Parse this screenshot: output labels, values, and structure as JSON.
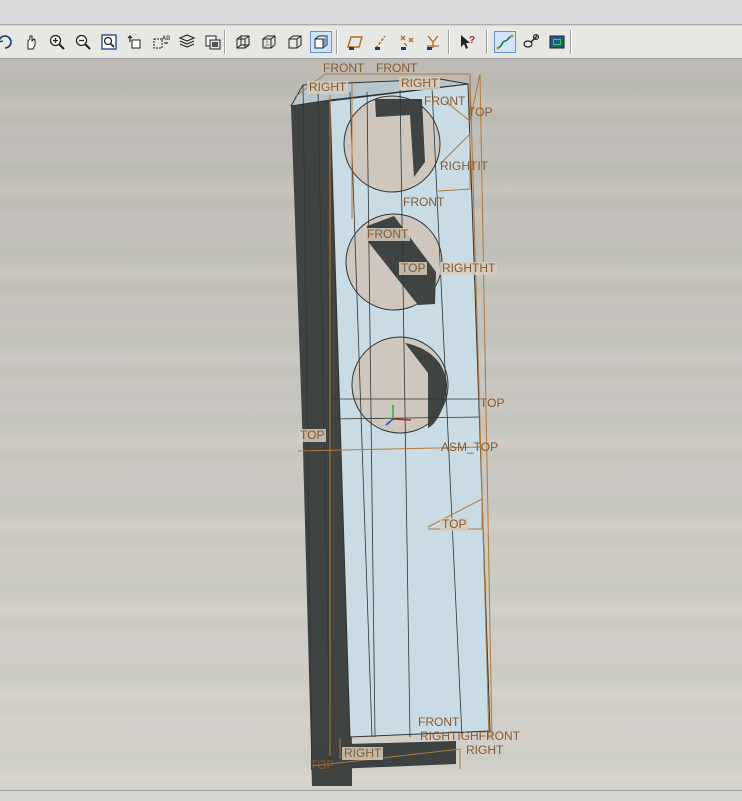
{
  "toolbar": {
    "buttons": [
      {
        "id": "repaint",
        "icon": "repaint-icon"
      },
      {
        "id": "spin",
        "icon": "spin-center-icon"
      },
      {
        "id": "zoom-in",
        "icon": "zoom-in-icon"
      },
      {
        "id": "zoom-out",
        "icon": "zoom-out-icon"
      },
      {
        "id": "refit",
        "icon": "refit-icon"
      },
      {
        "id": "reorient",
        "icon": "reorient-icon"
      },
      {
        "id": "saved-views",
        "icon": "saved-views-icon"
      },
      {
        "id": "layers",
        "icon": "layers-icon"
      },
      {
        "id": "view-manager",
        "icon": "view-manager-icon"
      },
      {
        "id": "wireframe",
        "icon": "wireframe-icon"
      },
      {
        "id": "hidden-line",
        "icon": "hidden-line-icon"
      },
      {
        "id": "no-hidden",
        "icon": "no-hidden-icon"
      },
      {
        "id": "shading",
        "icon": "shading-icon",
        "active": true
      },
      {
        "id": "datum-planes",
        "icon": "datum-planes-icon"
      },
      {
        "id": "datum-axes",
        "icon": "datum-axes-icon"
      },
      {
        "id": "datum-points",
        "icon": "datum-points-icon"
      },
      {
        "id": "coordinate-systems",
        "icon": "coordinate-systems-icon"
      },
      {
        "id": "context-help",
        "icon": "context-help-icon"
      },
      {
        "id": "sketch",
        "icon": "sketch-icon"
      },
      {
        "id": "annotation",
        "icon": "annotation-icon"
      },
      {
        "id": "display-toggle",
        "icon": "display-icon"
      }
    ],
    "help_label": "?"
  },
  "datum_labels": {
    "front_top": "FRONT",
    "front_top_2": "FRONT",
    "right_top_1": "RIGHT",
    "right_top_2": "RIGHT",
    "front_top_3": "FRONT",
    "top_1": "TOP",
    "right_1": "RIGHTIT",
    "front_mid": "FRONT",
    "front_mid_2": "FRONT",
    "top_mid": "TOP",
    "right_mid": "RIGHTHT",
    "top_right": "TOP",
    "top_left": "TOP",
    "asm_top": "ASM_TOP",
    "top_lower": "TOP",
    "front_bottom": "FRONT",
    "right_bottom": "RIGHTIGHFRONT",
    "right_bottom_2": "RIGHT",
    "right_bottom_3": "RIGHT",
    "top_bottom": "TOP"
  },
  "colors": {
    "face_light": "#c7dae3",
    "face_dark": "#3f4342",
    "datum_orange": "#b37a3e",
    "edge": "#2f3638"
  }
}
